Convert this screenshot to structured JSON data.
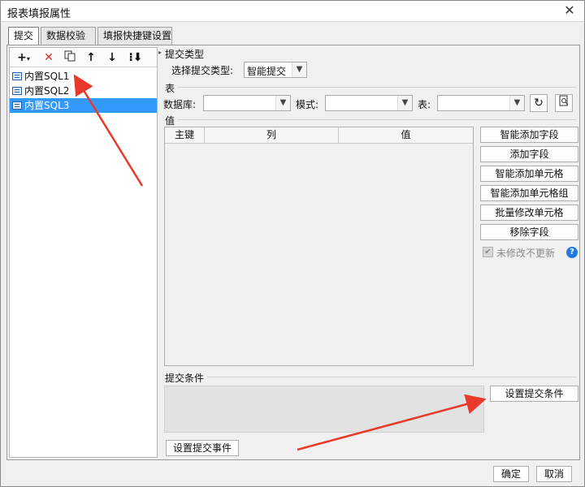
{
  "window": {
    "title": "报表填报属性"
  },
  "tabs": [
    {
      "label": "提交"
    },
    {
      "label": "数据校验"
    },
    {
      "label": "填报快捷键设置"
    }
  ],
  "tree": {
    "items": [
      {
        "label": "内置SQL1"
      },
      {
        "label": "内置SQL2"
      },
      {
        "label": "内置SQL3"
      }
    ]
  },
  "submit_type": {
    "section": "提交类型",
    "label": "选择提交类型:",
    "value": "智能提交"
  },
  "table_section": {
    "section": "表",
    "db_label": "数据库:",
    "db_value": "",
    "mode_label": "模式:",
    "mode_value": "",
    "table_label": "表:",
    "table_value": ""
  },
  "value_section": {
    "section": "值",
    "columns": [
      "主键",
      "列",
      "值"
    ]
  },
  "side_buttons": [
    "智能添加字段",
    "添加字段",
    "智能添加单元格",
    "智能添加单元格组",
    "批量修改单元格",
    "移除字段"
  ],
  "no_update_unmodified": {
    "label": "未修改不更新",
    "checked": true
  },
  "condition": {
    "section": "提交条件",
    "set_button": "设置提交条件"
  },
  "set_event_button": "设置提交事件",
  "footer": {
    "ok": "确定",
    "cancel": "取消"
  },
  "colors": {
    "selection": "#3399ff",
    "accent_arrow": "#e8392a",
    "help": "#1e7ae0"
  }
}
